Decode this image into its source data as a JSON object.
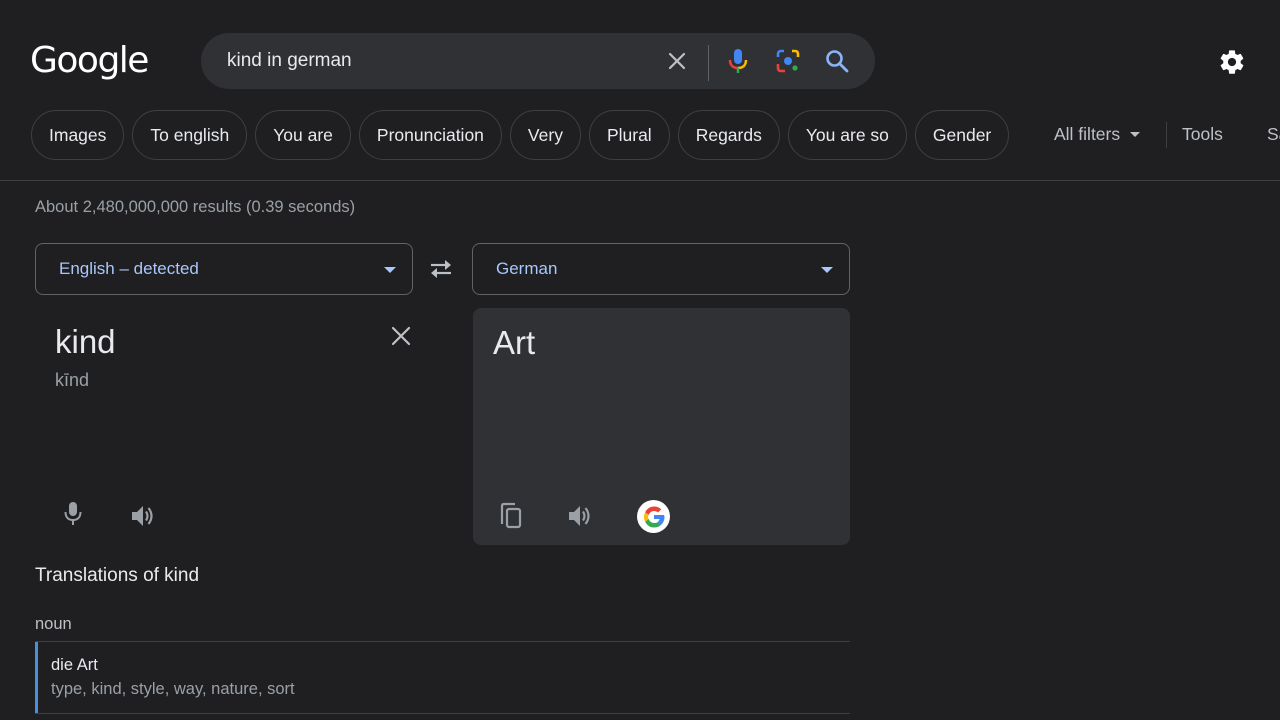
{
  "header": {
    "logo": "Google",
    "search": {
      "query": "kind in german",
      "icons": [
        "clear-icon",
        "mic-icon",
        "lens-icon",
        "search-icon"
      ]
    },
    "settings_icon": "gear-icon"
  },
  "chips": [
    {
      "label": "Images"
    },
    {
      "label": "To english"
    },
    {
      "label": "You are"
    },
    {
      "label": "Pronunciation"
    },
    {
      "label": "Very"
    },
    {
      "label": "Plural"
    },
    {
      "label": "Regards"
    },
    {
      "label": "You are so"
    },
    {
      "label": "Gender"
    }
  ],
  "filters": {
    "all_filters": "All filters",
    "tools": "Tools",
    "safesearch": "SafeSearch"
  },
  "stats": "About 2,480,000,000 results (0.39 seconds)",
  "translator": {
    "source_lang": "English – detected",
    "target_lang": "German",
    "source_word": "kind",
    "source_phonetic": "kīnd",
    "target_word": "Art"
  },
  "translations": {
    "title": "Translations of kind",
    "part_of_speech": "noun",
    "entries": [
      {
        "word": "die Art",
        "synonyms": "type, kind, style, way, nature, sort"
      }
    ]
  },
  "colors": {
    "background": "#1f1f22",
    "surface": "#303134",
    "accent_blue": "#a8c7fa",
    "entry_bar": "#4a8fdd"
  }
}
